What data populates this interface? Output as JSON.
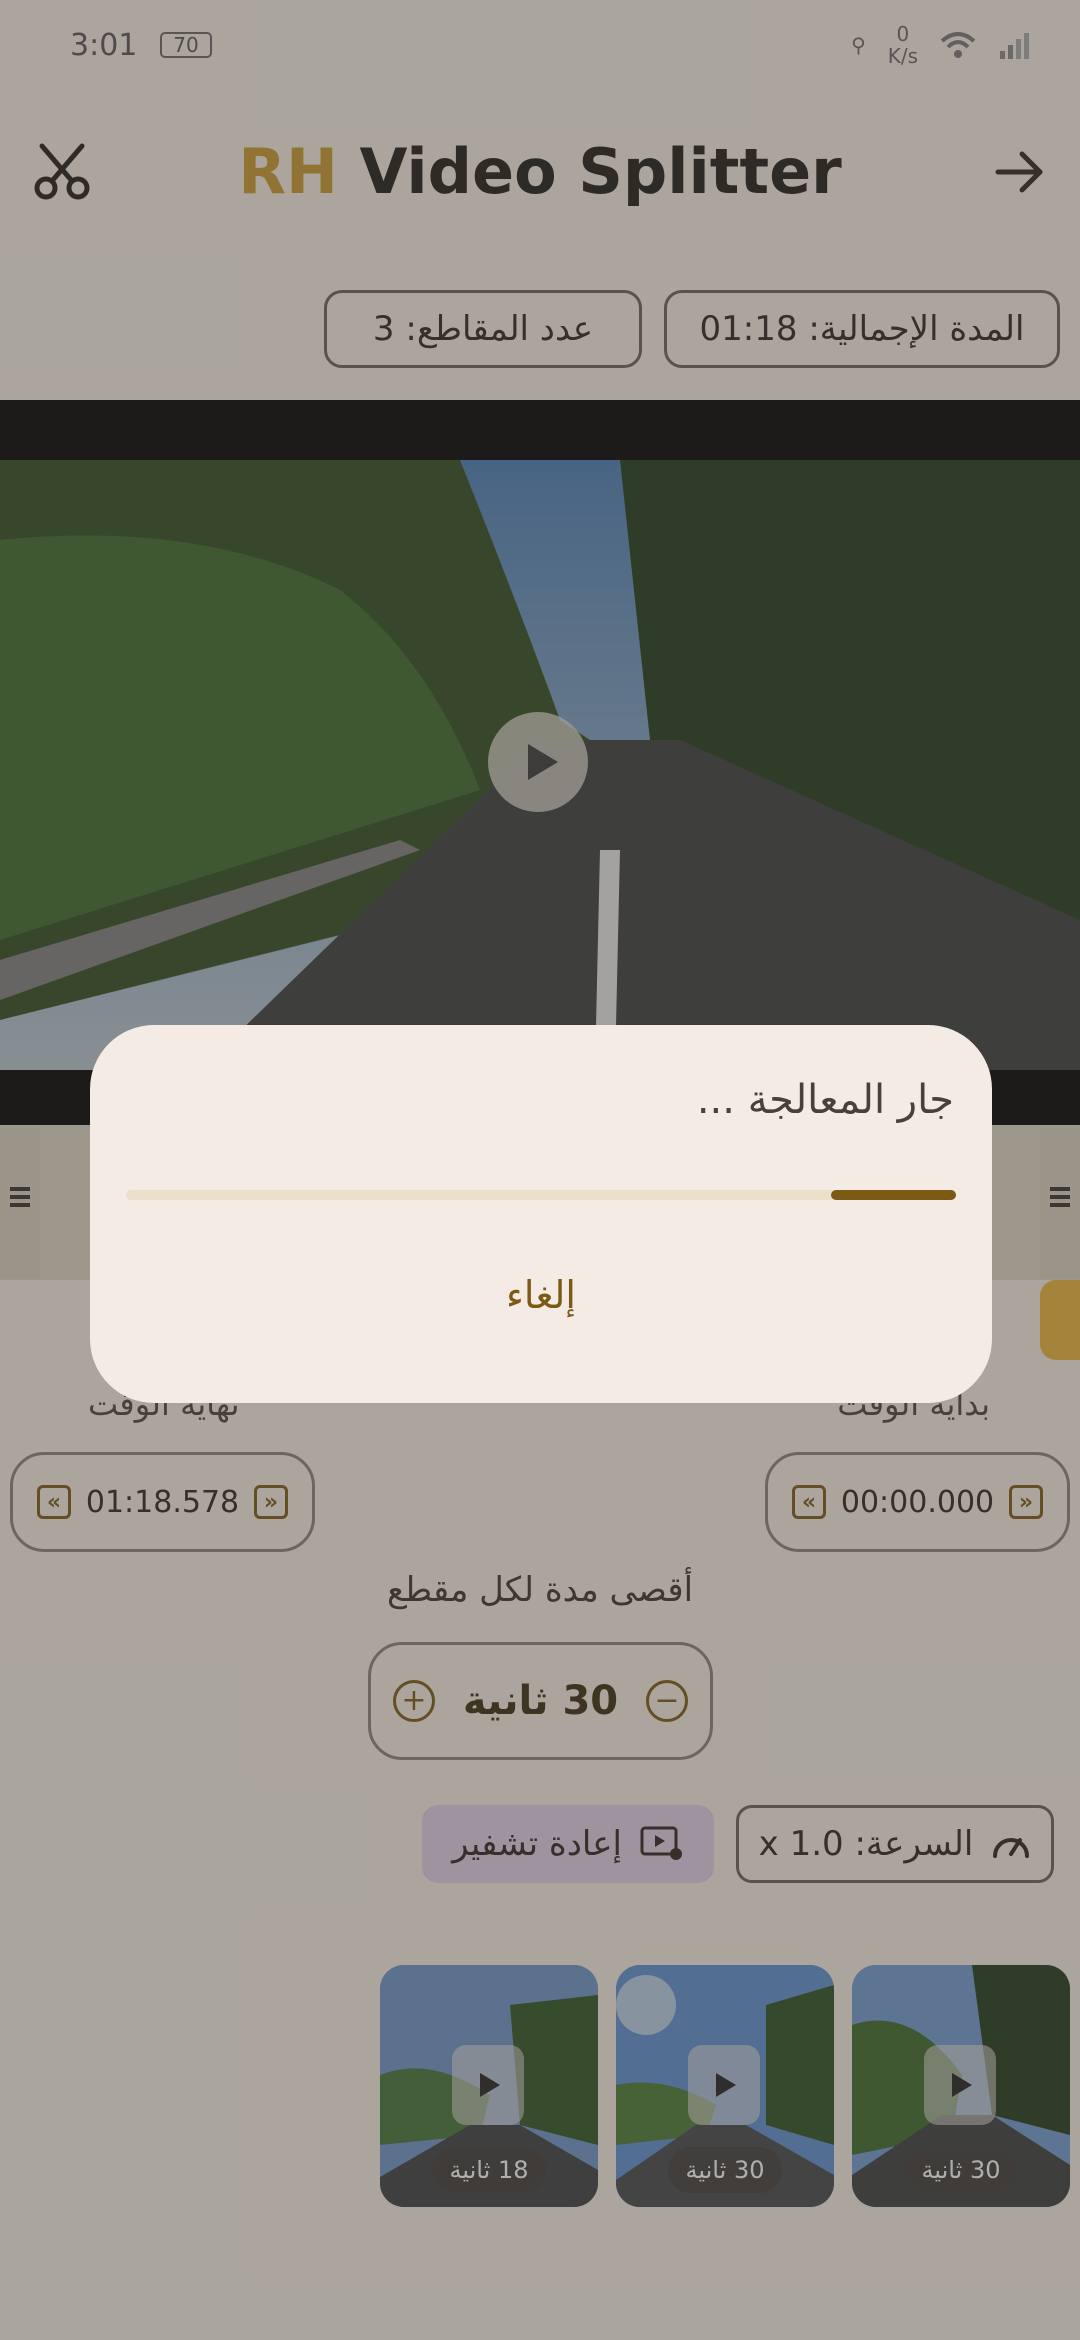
{
  "status_bar": {
    "time": "3:01",
    "battery": "70",
    "net_speed_value": "0",
    "net_speed_unit": "K/s"
  },
  "header": {
    "brand": "RH",
    "title_rest": " Video Splitter"
  },
  "info": {
    "total_duration": "المدة الإجمالية: 01:18",
    "segment_count": "عدد المقاطع: 3"
  },
  "time_fields": {
    "start_label": "بداية الوقت",
    "start_value": "00:00.000",
    "end_label": "نهاية الوقت",
    "end_value": "01:18.578"
  },
  "max_duration": {
    "label": "أقصى مدة لكل مقطع",
    "value": "30 ثانية"
  },
  "actions": {
    "reencode_label": "إعادة تشفير",
    "speed_label": "السرعة: 1.0 x"
  },
  "clips": [
    {
      "duration": "30 ثانية"
    },
    {
      "duration": "30 ثانية"
    },
    {
      "duration": "18 ثانية"
    }
  ],
  "dialog": {
    "title": "جار المعالجة ...",
    "cancel_label": "إلغاء",
    "progress": 0.15
  },
  "colors": {
    "accent": "#7a5a14",
    "brand": "#c99a2e"
  }
}
